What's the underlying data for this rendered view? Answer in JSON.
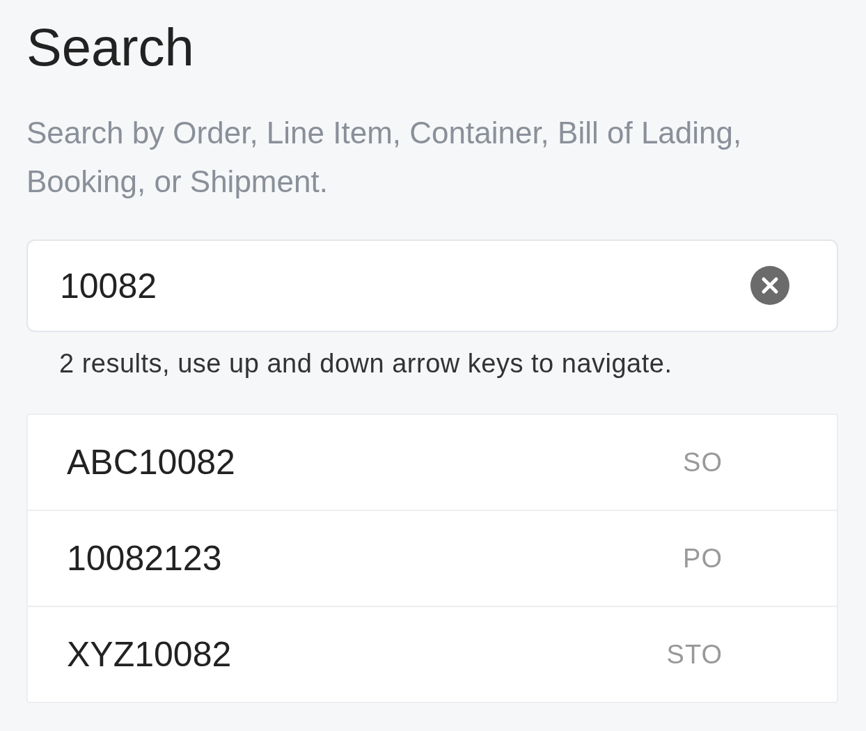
{
  "title": "Search",
  "description": "Search by Order, Line Item, Container, Bill of Lading, Booking, or Shipment.",
  "search": {
    "value": "10082"
  },
  "helper": "2 results, use up and down arrow keys to navigate.",
  "results": [
    {
      "label": "ABC10082",
      "type": "SO"
    },
    {
      "label": "10082123",
      "type": "PO"
    },
    {
      "label": "XYZ10082",
      "type": "STO"
    }
  ]
}
